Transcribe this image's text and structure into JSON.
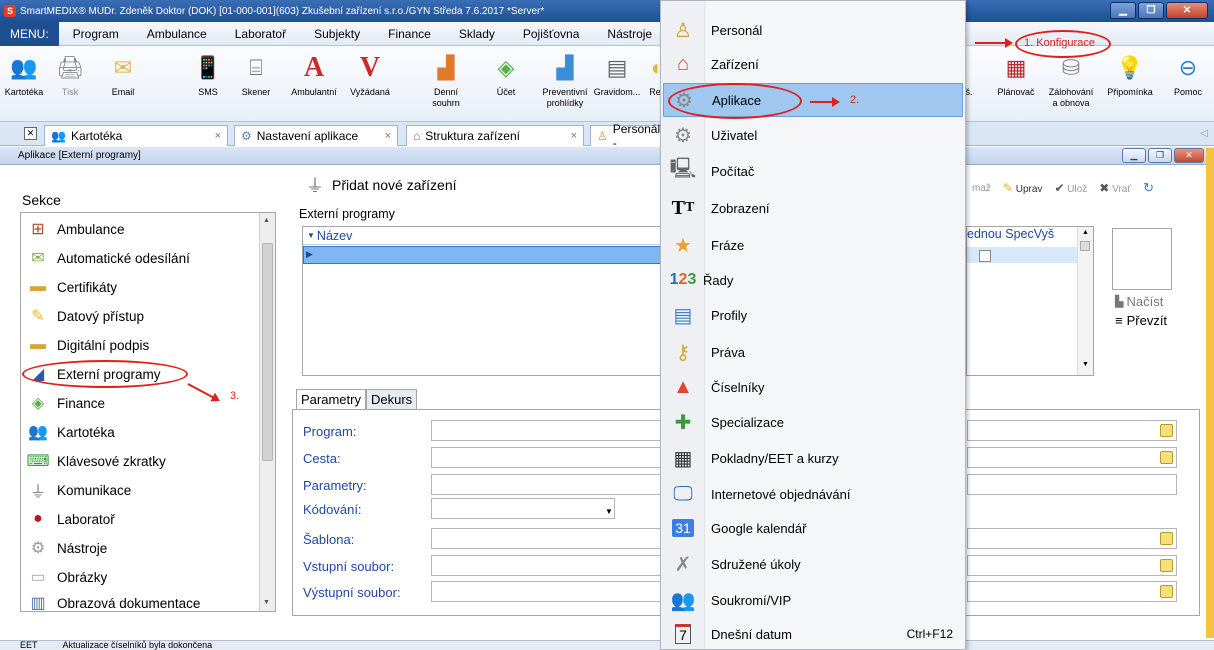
{
  "window": {
    "title": "SmartMEDIX®   MUDr. Zdeněk Doktor (DOK) [01-000-001](603)   Zkušební zařízení s.r.o./GYN   Středa 7.6.2017   *Server*",
    "controls": [
      "▁",
      "❐",
      "✕"
    ]
  },
  "menubar": {
    "menu_label": "MENU:",
    "items": [
      "Program",
      "Ambulance",
      "Laboratoř",
      "Subjekty",
      "Finance",
      "Sklady",
      "Pojišťovna",
      "Nástroje"
    ]
  },
  "toolbar": {
    "items": [
      {
        "label": "Kartotéka",
        "icon": "people-icon"
      },
      {
        "label": "Tisk",
        "icon": "printer-icon"
      },
      {
        "label": "Email",
        "icon": "email-icon"
      },
      {
        "label": "SMS",
        "icon": "phone-icon"
      },
      {
        "label": "Skener",
        "icon": "scanner-icon"
      },
      {
        "label": "Ambulantní",
        "icon": "ambulance-letter-icon"
      },
      {
        "label": "Vyžádaná",
        "icon": "requested-letter-icon"
      },
      {
        "label": "Denní souhrn",
        "icon": "chart-icon"
      },
      {
        "label": "Účet",
        "icon": "bill-icon"
      },
      {
        "label": "Preventivní prohlídky",
        "icon": "prevention-chart-icon"
      },
      {
        "label": "Gravidom...",
        "icon": "gravidom-icon"
      },
      {
        "label": "Re",
        "icon": "re-icon"
      }
    ],
    "right_items": [
      {
        "label": "š.",
        "icon": "partial-icon"
      },
      {
        "label": "Plánovač",
        "icon": "calendar-icon"
      },
      {
        "label": "Zálohování a obnova",
        "icon": "backup-icon"
      },
      {
        "label": "Připomínka",
        "icon": "bulb-icon"
      },
      {
        "label": "Pomoc",
        "icon": "help-icon"
      }
    ]
  },
  "tabs": [
    {
      "label": "Kartotéka"
    },
    {
      "label": "Nastavení aplikace"
    },
    {
      "label": "Struktura zařízení"
    },
    {
      "label": "Personál -"
    }
  ],
  "inner_window": {
    "title": "Aplikace [Externí programy]"
  },
  "sekce": {
    "title": "Sekce",
    "items": [
      "Ambulance",
      "Automatické odesílání",
      "Certifikáty",
      "Datový přístup",
      "Digitální podpis",
      "Externí programy",
      "Finance",
      "Kartotéka",
      "Klávesové zkratky",
      "Komunikace",
      "Laboratoř",
      "Nástroje",
      "Obrázky",
      "Obrazová dokumentace"
    ]
  },
  "main": {
    "add_device": "Přidat nové zařízení",
    "external_programs_label": "Externí programy",
    "grid_header": "Název",
    "grid2_header": "ednou SpecVyš",
    "load_label": "Načíst",
    "take_label": "Převzít",
    "right_tools": [
      "maž",
      "Uprav",
      "Ulož",
      "Vrať"
    ],
    "param_tabs": [
      "Parametry",
      "Dekurs"
    ],
    "fields": [
      "Program:",
      "Cesta:",
      "Parametry:",
      "Kódování:",
      "Šablona:",
      "Vstupní soubor:",
      "Výstupní soubor:"
    ]
  },
  "dropdown": {
    "items": [
      {
        "label": "Personál",
        "icon": "personnel-icon"
      },
      {
        "label": "Zařízení",
        "icon": "house-icon"
      },
      {
        "label": "Aplikace",
        "icon": "gears-icon",
        "selected": true
      },
      {
        "label": "Uživatel",
        "icon": "gear-user-icon"
      },
      {
        "label": "Počítač",
        "icon": "computer-icon"
      },
      {
        "label": "Zobrazení",
        "icon": "font-icon"
      },
      {
        "label": "Fráze",
        "icon": "star-folder-icon"
      },
      {
        "label": "Řady",
        "icon": "numbers-icon"
      },
      {
        "label": "Profily",
        "icon": "profile-icon"
      },
      {
        "label": "Práva",
        "icon": "key-icon"
      },
      {
        "label": "Číselníky",
        "icon": "codelist-icon"
      },
      {
        "label": "Specializace",
        "icon": "puzzle-icon"
      },
      {
        "label": "Pokladny/EET a kurzy",
        "icon": "calculator-icon"
      },
      {
        "label": "Internetové objednávání",
        "icon": "monitor-icon"
      },
      {
        "label": "Google kalendář",
        "icon": "google-calendar-icon"
      },
      {
        "label": "Sdružené úkoly",
        "icon": "tools-icon"
      },
      {
        "label": "Soukromí/VIP",
        "icon": "vip-icon"
      },
      {
        "label": "Dnešní datum",
        "icon": "today-icon",
        "shortcut": "Ctrl+F12"
      }
    ]
  },
  "annotations": {
    "step1": "1. Konfigurace",
    "step2": "2.",
    "step3": "3."
  },
  "status": {
    "left": "EET",
    "message": "Aktualizace číselníků byla dokončena"
  }
}
